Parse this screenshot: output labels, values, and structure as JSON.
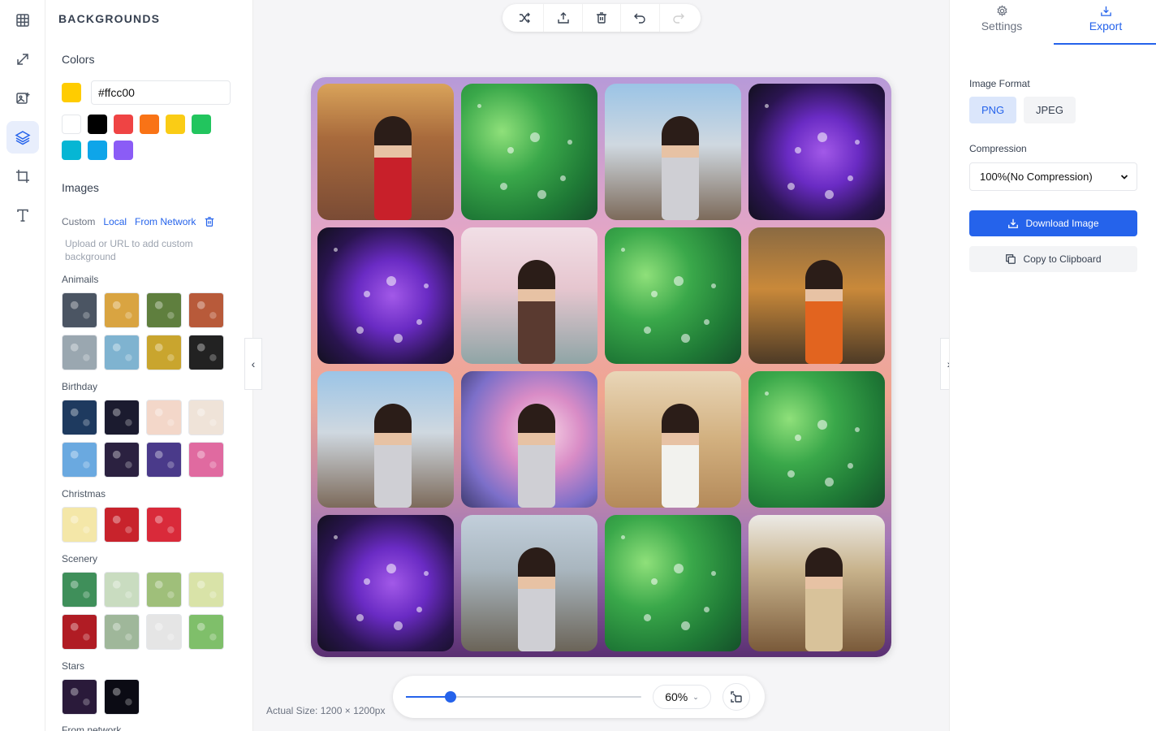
{
  "left_rail": {
    "items": [
      {
        "name": "layout-grid-icon",
        "active": false
      },
      {
        "name": "resize-icon",
        "active": false
      },
      {
        "name": "image-edit-icon",
        "active": false
      },
      {
        "name": "layers-icon",
        "active": true
      },
      {
        "name": "crop-icon",
        "active": false
      },
      {
        "name": "text-icon",
        "active": false
      }
    ]
  },
  "backgrounds": {
    "title": "BACKGROUNDS",
    "colors_title": "Colors",
    "hex_value": "#ffcc00",
    "current_color": "#ffcc00",
    "swatches": [
      "#ffffff",
      "#000000",
      "#ef4444",
      "#f97316",
      "#facc15",
      "#22c55e",
      "#06b6d4",
      "#0ea5e9",
      "#8b5cf6"
    ],
    "images_title": "Images",
    "source_tabs": [
      {
        "label": "Custom",
        "active": false
      },
      {
        "label": "Local",
        "active": true
      },
      {
        "label": "From Network",
        "active": true
      }
    ],
    "hint": "Upload or URL to add custom background",
    "categories": [
      {
        "name": "Animails",
        "thumbs": [
          "#4b5563",
          "#d9a441",
          "#5f7f3e",
          "#b85a3a",
          "#9aa7b0",
          "#7fb3d0",
          "#c9a52e",
          "#222222"
        ]
      },
      {
        "name": "Birthday",
        "thumbs": [
          "#1e3a5f",
          "#1b1b2f",
          "#f3d7c9",
          "#efe3d8",
          "#6aa9e0",
          "#2b2140",
          "#4a3a8a",
          "#e06aa0"
        ]
      },
      {
        "name": "Christmas",
        "thumbs": [
          "#f4e7a8",
          "#c8232c",
          "#d92a3a"
        ]
      },
      {
        "name": "Scenery",
        "thumbs": [
          "#3f8f5a",
          "#c9dcc0",
          "#9fbf7a",
          "#d9e3a8",
          "#b01c24",
          "#9fb79a",
          "#e5e5e5",
          "#7fbf6a"
        ]
      },
      {
        "name": "Stars",
        "thumbs": [
          "#2a1a3a",
          "#0b0b14"
        ]
      }
    ],
    "cut_off_label": "From network"
  },
  "toolbar": {
    "tools": [
      {
        "name": "shuffle-icon",
        "enabled": true
      },
      {
        "name": "upload-icon",
        "enabled": true
      },
      {
        "name": "trash-icon",
        "enabled": true
      },
      {
        "name": "undo-icon",
        "enabled": true
      },
      {
        "name": "redo-icon",
        "enabled": false
      }
    ]
  },
  "canvas": {
    "tiles": [
      "venice",
      "clover",
      "person",
      "flower",
      "flower",
      "taj",
      "clover",
      "machu",
      "person",
      "blossom",
      "pyramid",
      "clover",
      "flower",
      "paris",
      "clover",
      "london"
    ]
  },
  "zoom": {
    "value_fraction": 0.19,
    "label": "60%",
    "actual_size": "Actual Size: 1200 × 1200px"
  },
  "right_panel": {
    "tabs": [
      {
        "label": "Settings",
        "icon": "gear-icon",
        "active": false
      },
      {
        "label": "Export",
        "icon": "download-icon",
        "active": true
      }
    ],
    "image_format_label": "Image Format",
    "formats": [
      {
        "label": "PNG",
        "active": true
      },
      {
        "label": "JPEG",
        "active": false
      }
    ],
    "compression_label": "Compression",
    "compression_value": "100%(No Compression)",
    "download_label": "Download Image",
    "copy_label": "Copy to Clipboard"
  }
}
